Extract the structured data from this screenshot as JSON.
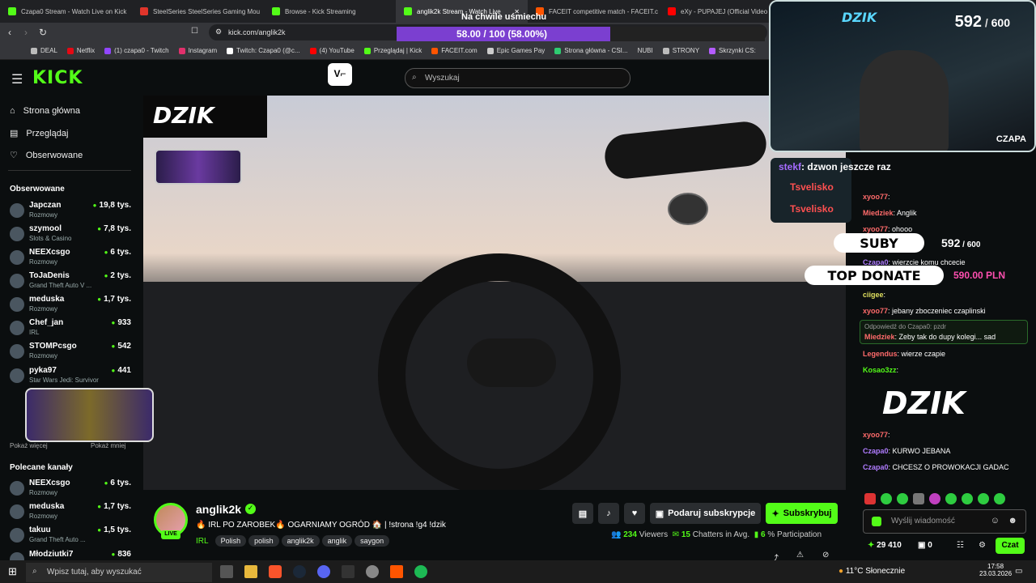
{
  "browser": {
    "tabs": [
      {
        "label": "Czapa0 Stream - Watch Live on Kick",
        "color": "#53fc18"
      },
      {
        "label": "SteelSeries SteelSeries Gaming Mou",
        "color": "#e0352b"
      },
      {
        "label": "Browse - Kick Streaming",
        "color": "#53fc18"
      },
      {
        "label": "anglik2k Stream - Watch Live",
        "color": "#53fc18"
      },
      {
        "label": "FACEIT competitive match - FACEIT.c",
        "color": "#ff5500"
      },
      {
        "label": "eXy - PUPAJEJ (Official Video 20",
        "color": "#ff0000"
      }
    ],
    "url": "kick.com/anglik2k",
    "bookmarks": [
      "DEAL",
      "Netflix",
      "(1) czapa0 - Twitch",
      "Instagram",
      "Twitch: Czapa0 (@c...",
      "(4) YouTube",
      "Przeglądaj | Kick",
      "FACEIT.com",
      "Epic Games Pay",
      "Strona główna - CSI...",
      "NUBI",
      "STRONY",
      "Skrzynki CS:"
    ]
  },
  "overlay": {
    "top_caption": "Na chwile uśmiechu",
    "goal_bar": "58.00 / 100 (58.00%)",
    "goal_fraction": 0.58,
    "sub_count": "592",
    "sub_goal": "600",
    "cam_label": "CZAPA",
    "brand": "DZIK",
    "suby_label": "SUBY",
    "suby_count": "592",
    "suby_goal": "600",
    "top_donate_label": "TOP DONATE",
    "top_donate_value": "590.00 PLN"
  },
  "kick": {
    "logo": "KICK",
    "search_placeholder": "Wyszukaj",
    "nav": [
      "Strona główna",
      "Przeglądaj",
      "Obserwowane"
    ],
    "followed_title": "Obserwowane",
    "followed": [
      {
        "name": "Japczan",
        "cat": "Rozmowy",
        "viewers": "19,8 tys."
      },
      {
        "name": "szymool",
        "cat": "Slots & Casino",
        "viewers": "7,8 tys."
      },
      {
        "name": "NEEXcsgo",
        "cat": "Rozmowy",
        "viewers": "6 tys."
      },
      {
        "name": "ToJaDenis",
        "cat": "Grand Theft Auto V ...",
        "viewers": "2 tys."
      },
      {
        "name": "meduska",
        "cat": "Rozmowy",
        "viewers": "1,7 tys."
      },
      {
        "name": "Chef_jan",
        "cat": "IRL",
        "viewers": "933"
      },
      {
        "name": "STOMPcsgo",
        "cat": "Rozmowy",
        "viewers": "542"
      },
      {
        "name": "pyka97",
        "cat": "Star Wars Jedi: Survivor",
        "viewers": "441"
      }
    ],
    "show_more": "Pokaż więcej",
    "show_less": "Pokaż mniej",
    "recommended_title": "Polecane kanały",
    "recommended": [
      {
        "name": "NEEXcsgo",
        "cat": "Rozmowy",
        "viewers": "6 tys."
      },
      {
        "name": "meduska",
        "cat": "Rozmowy",
        "viewers": "1,7 tys."
      },
      {
        "name": "takuu",
        "cat": "Grand Theft Auto ...",
        "viewers": "1,5 tys."
      },
      {
        "name": "Młodziutki7",
        "cat": "",
        "viewers": "836"
      }
    ]
  },
  "stream": {
    "streamer": "anglik2k",
    "live_badge": "LIVE",
    "title": "🔥 IRL PO ZAROBEK🔥 OGARNIAMY OGRÓD 🏠 | !strona !g4 !dzik",
    "category": "IRL",
    "tags": [
      "Polish",
      "polish",
      "anglik2k",
      "anglik",
      "saygon"
    ],
    "gift_label": "Podaruj subskrypcje",
    "subscribe_label": "Subskrybuj",
    "viewers": "234",
    "viewers_label": "Viewers",
    "chatters": "15",
    "chatters_label": "Chatters in Avg.",
    "participation": "6",
    "participation_label": "% Participation"
  },
  "chat": {
    "messages": [
      {
        "user": "stekf",
        "text": "dzwon jeszcze raz"
      },
      {
        "user": "Tsvelisko",
        "text": ""
      },
      {
        "user": "Tsvelisko",
        "text": ""
      },
      {
        "user": "xyoo77",
        "text": ""
      },
      {
        "user": "Miedziek",
        "text": "Anglik"
      },
      {
        "user": "xyoo77",
        "text": "ohooo"
      },
      {
        "user": "Czapa0",
        "text": "wierzcie komu chcecie"
      },
      {
        "user": "ciigee",
        "text": ""
      },
      {
        "user": "xyoo77",
        "text": "jebany zboczeniec czaplinski"
      },
      {
        "user": "Miedziek",
        "text": "Zeby tak do dupy kolegi... sad"
      },
      {
        "user": "Legendus",
        "text": "wierze czapie"
      },
      {
        "user": "Kosao3zz",
        "text": ""
      },
      {
        "user": "xyoo77",
        "text": ""
      },
      {
        "user": "Czapa0",
        "text": "KURWO JEBANA"
      },
      {
        "user": "Czapa0",
        "text": "CHCESZ O PROWOKACJI GADAC"
      }
    ],
    "reply_hint": "Odpowiedź do Czapa0: pzdr",
    "input_placeholder": "Wyślij wiadomość",
    "points": "29 410",
    "gifts": "0",
    "send_label": "Czat"
  },
  "taskbar": {
    "search_placeholder": "Wpisz tutaj, aby wyszukać",
    "weather": "11°C  Słonecznie",
    "time": "17:58",
    "date": "23.03.2026"
  }
}
